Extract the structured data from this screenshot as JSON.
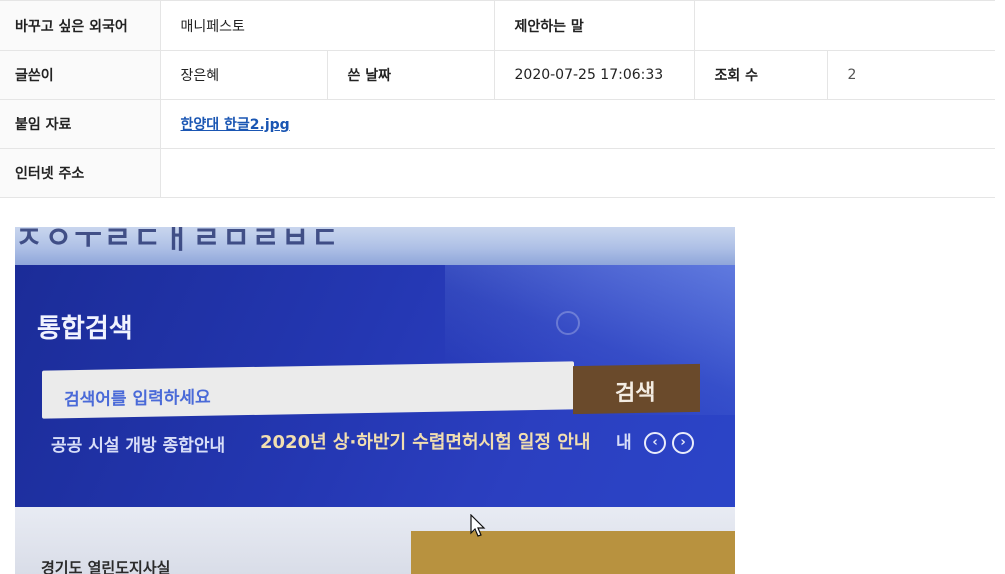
{
  "rows": {
    "foreign_word_label": "바꾸고 싶은 외국어",
    "foreign_word_value": "매니페스토",
    "suggestion_label": "제안하는 말",
    "suggestion_value": "",
    "author_label": "글쓴이",
    "author_value": "장은혜",
    "date_label": "쓴 날짜",
    "date_value": "2020-07-25 17:06:33",
    "views_label": "조회 수",
    "views_value": "2",
    "attachment_label": "붙임 자료",
    "attachment_file": "한양대 한글2.jpg",
    "url_label": "인터넷 주소",
    "url_value": ""
  },
  "photo": {
    "top_text": "ㅈㅇㅜㄹㄷㅐㄹㅁㄹㅂㄷ",
    "title": "통합검색",
    "search_placeholder": "검색어를 입력하세요",
    "search_button": "검색",
    "link_1": "공공 시설 개방 종합안내",
    "link_2": "2020년 상·하반기 수렵면허시험 일정 안내",
    "link_3": "내",
    "bottom_text": "경기도 열린도지사실"
  }
}
